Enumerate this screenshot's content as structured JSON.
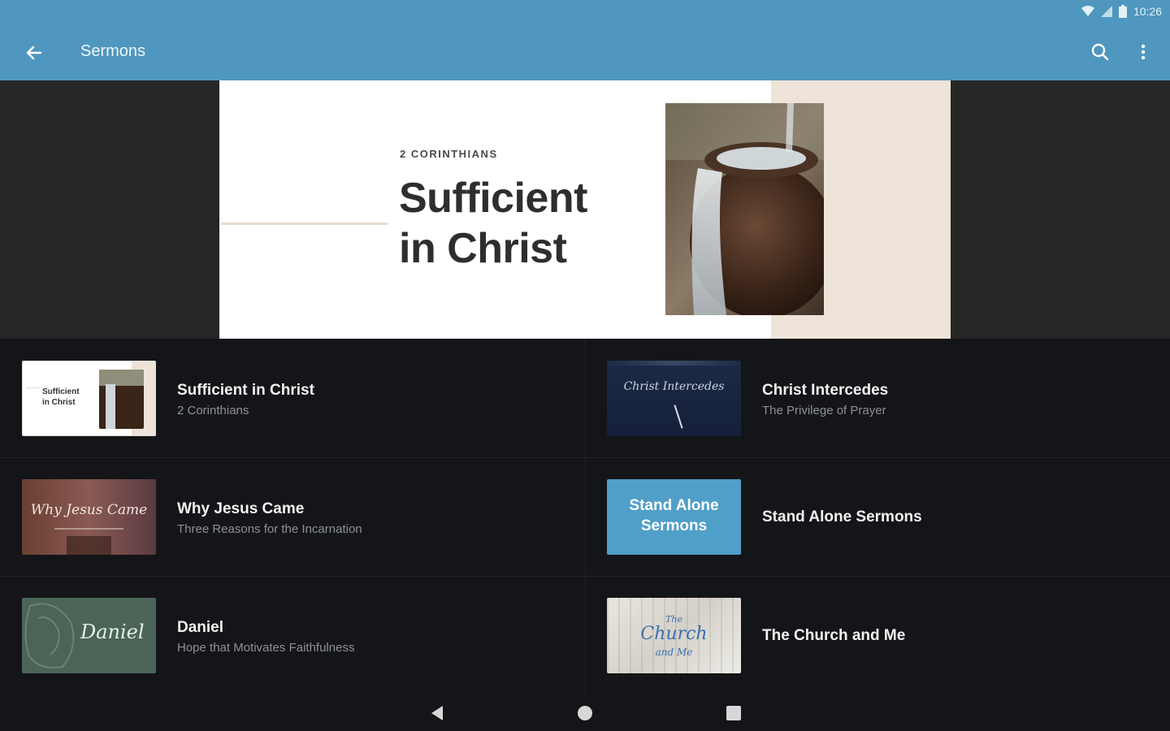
{
  "status": {
    "time": "10:26"
  },
  "appbar": {
    "title": "Sermons"
  },
  "hero": {
    "kicker": "2 CORINTHIANS",
    "title_line1": "Sufficient",
    "title_line2": "in Christ"
  },
  "series": [
    {
      "title": "Sufficient in Christ",
      "subtitle": "2 Corinthians",
      "thumb_text_1": "Sufficient",
      "thumb_text_2": "in Christ"
    },
    {
      "title": "Christ Intercedes",
      "subtitle": "The Privilege of Prayer",
      "thumb_text": "Christ Intercedes"
    },
    {
      "title": "Why Jesus Came",
      "subtitle": "Three Reasons for the Incarnation",
      "thumb_text": "Why Jesus Came"
    },
    {
      "title": "Stand Alone Sermons",
      "subtitle": "",
      "thumb_text_1": "Stand Alone",
      "thumb_text_2": "Sermons"
    },
    {
      "title": "Daniel",
      "subtitle": "Hope that Motivates Faithfulness",
      "thumb_text": "Daniel"
    },
    {
      "title": "The Church and Me",
      "subtitle": "",
      "thumb_text_1": "The",
      "thumb_text_2": "Church",
      "thumb_text_3": "and Me"
    }
  ],
  "colors": {
    "appbar": "#4f97be",
    "background": "#141518",
    "hero_beige": "#ede3d8",
    "stand_alone": "#4f9fc8"
  },
  "icons": [
    "back-arrow-icon",
    "search-icon",
    "more-vert-icon",
    "wifi-icon",
    "signal-icon",
    "battery-icon",
    "nav-back-icon",
    "nav-home-icon",
    "nav-recents-icon"
  ]
}
